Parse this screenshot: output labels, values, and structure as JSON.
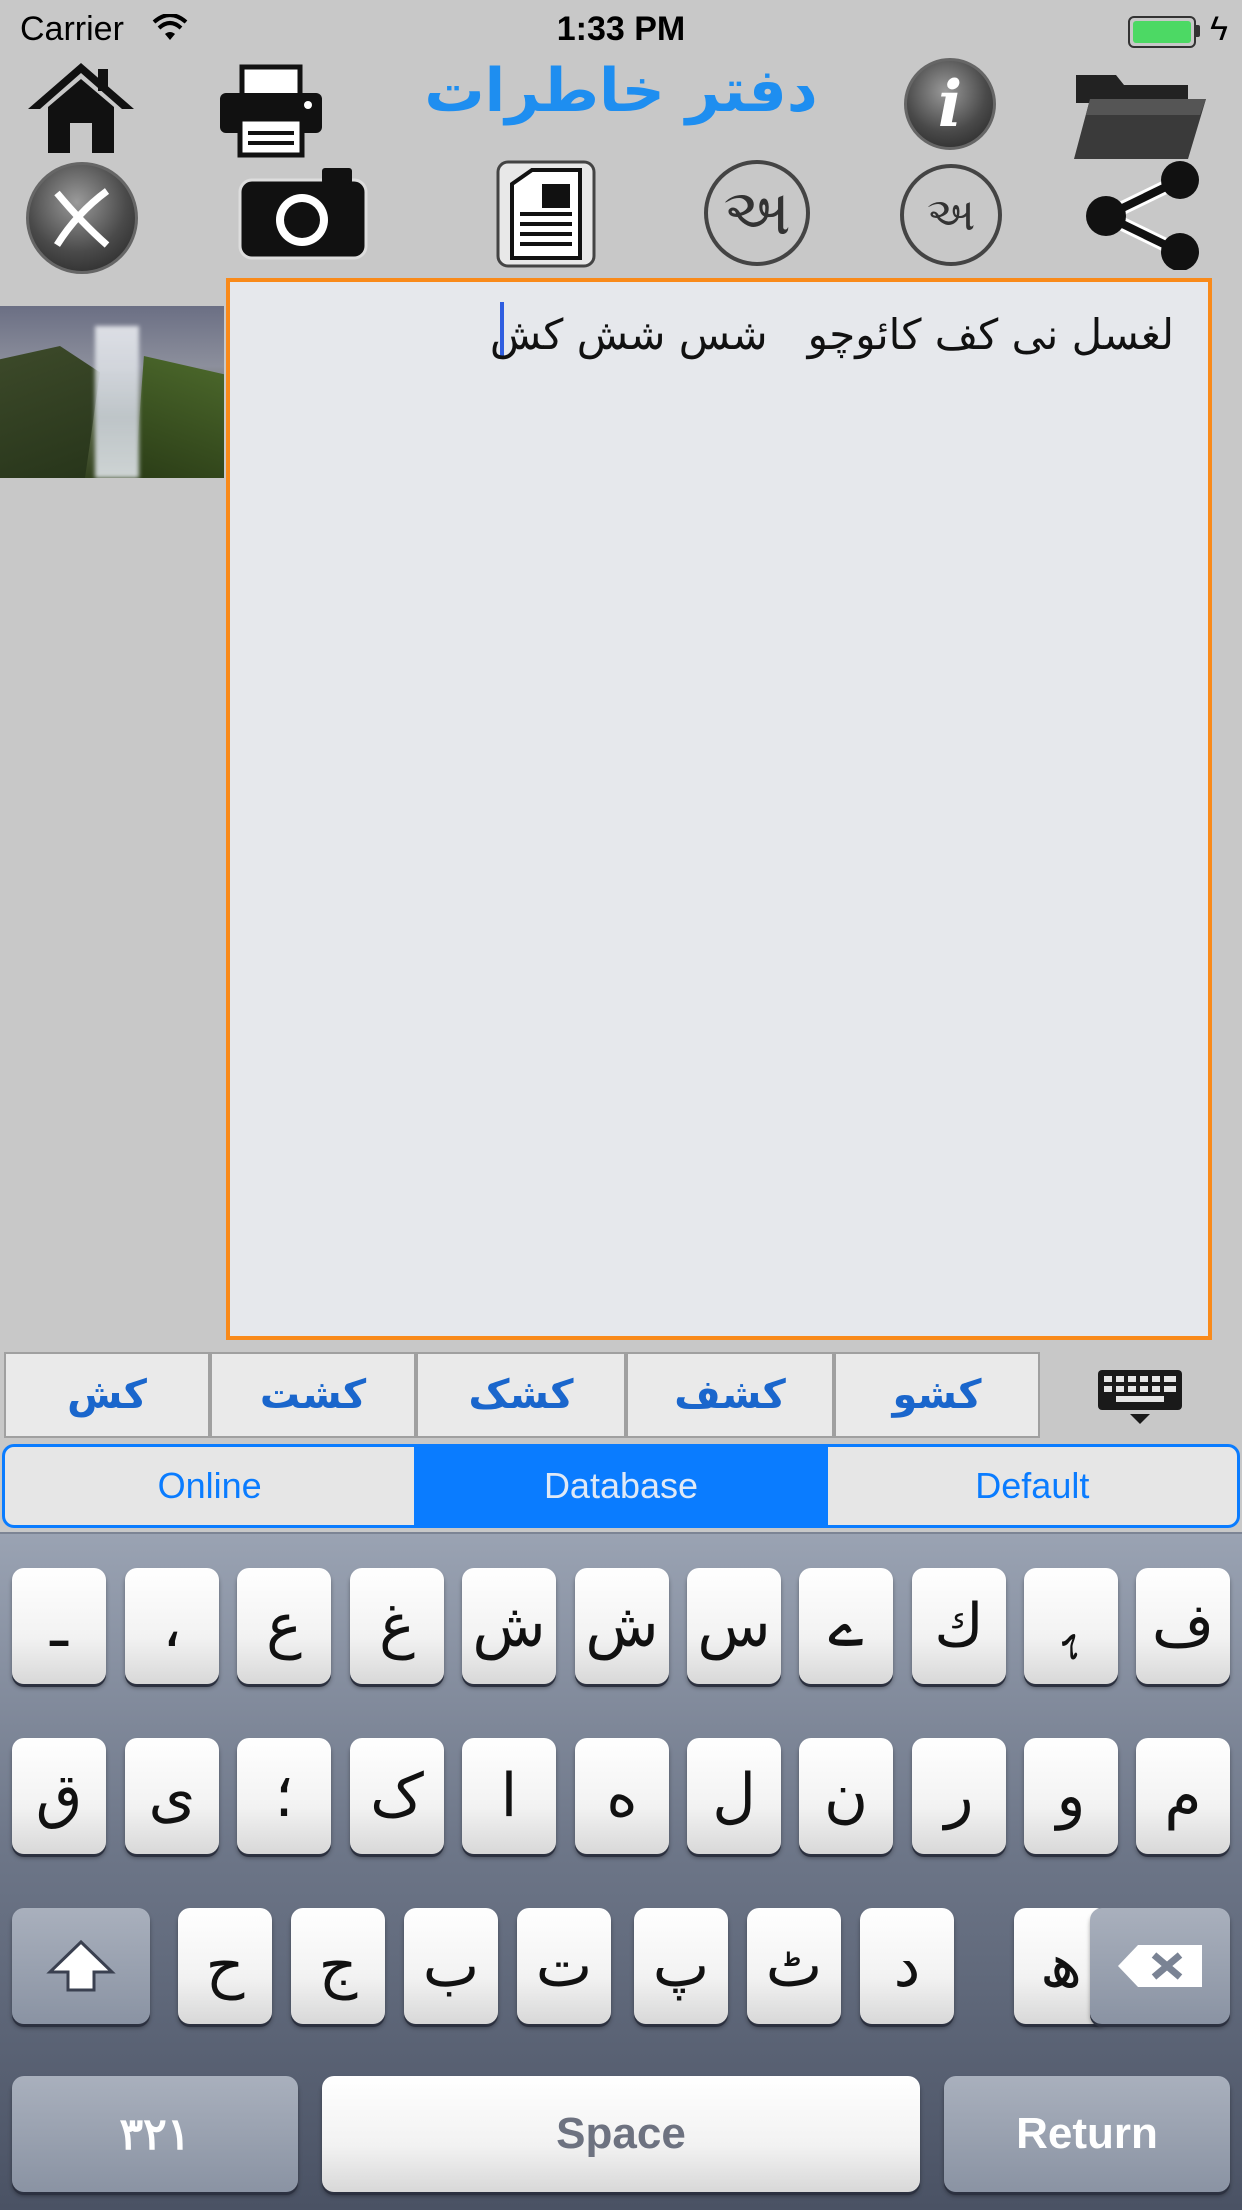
{
  "status_bar": {
    "carrier": "Carrier",
    "time": "1:33 PM"
  },
  "app": {
    "title": "دفتر خاطرات"
  },
  "toolbar": {
    "row1": [
      "home-icon",
      "printer-icon",
      "info-icon",
      "folder-icon"
    ],
    "row2": [
      "close-icon",
      "camera-icon",
      "document-icon",
      "gujarati-large-icon",
      "gujarati-small-icon",
      "share-icon"
    ],
    "info_glyph": "i",
    "gujarati_large": "અ",
    "gujarati_small": "અ"
  },
  "editor": {
    "text": "لغسل نی کف کائوچو   شس شش کش",
    "border_color": "#f98a1a"
  },
  "suggestions": [
    "کش",
    "کشت",
    "کشک",
    "کشف",
    "کشو"
  ],
  "segmented": {
    "options": [
      "Online",
      "Database",
      "Default"
    ],
    "selected": "Database"
  },
  "keyboard": {
    "row1": [
      "ف",
      "ﮨ",
      "ك",
      "ے",
      "س",
      "ش",
      "ش",
      "غ",
      "ع",
      "،",
      "ـ"
    ],
    "row2": [
      "م",
      "و",
      "ر",
      "ن",
      "ل",
      "ه",
      "ا",
      "ک",
      "؛",
      "ی",
      "ق"
    ],
    "row3": [
      "ھ",
      "د",
      "ٹ",
      "پ",
      "ت",
      "ب",
      "ج",
      "ح"
    ],
    "numbers_label": "۳۲۱",
    "space_label": "Space",
    "return_label": "Return"
  },
  "colors": {
    "accent": "#0a7cff",
    "title": "#1e8ef0",
    "suggestion": "#1a66cc",
    "battery": "#4cd964"
  }
}
